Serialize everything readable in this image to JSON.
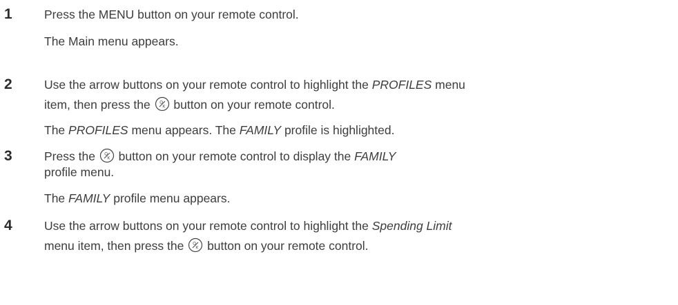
{
  "steps": [
    {
      "number": "1",
      "instruction": [
        "Press the MENU button on your remote control."
      ],
      "result": [
        "The Main menu appears."
      ]
    },
    {
      "number": "2",
      "instruction_l1": {
        "a": "Use the arrow buttons on your remote control to highlight the ",
        "b": "PROFILES",
        "c": " menu"
      },
      "instruction_l2": {
        "a": "item, then press the ",
        "b": " button on your remote control."
      },
      "result": {
        "a": "The ",
        "b": "PROFILES",
        "c": " menu appears. The ",
        "d": "FAMILY",
        "e": " profile is highlighted."
      }
    },
    {
      "number": "3",
      "instruction_l1": {
        "a": "Press the ",
        "b": " button on your remote control to display the ",
        "c": "FAMILY"
      },
      "instruction_l2": "profile menu.",
      "result": {
        "a": "The ",
        "b": "FAMILY",
        "c": " profile menu appears."
      }
    },
    {
      "number": "4",
      "instruction_l1": {
        "a": "Use the arrow buttons on your remote control to highlight the ",
        "b": "Spending Limit"
      },
      "instruction_l2": {
        "a": "menu item, then press the ",
        "b": " button on your remote control."
      }
    }
  ],
  "icons": {
    "ok_button": "ok-button-icon"
  }
}
